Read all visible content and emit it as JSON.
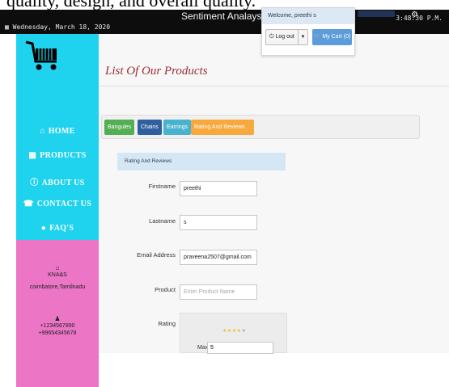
{
  "background_snippet": "quality, design, and overall quality.",
  "titlebar": {
    "date": "Wednesday, March 18, 2020",
    "title": "Sentiment Analaysis",
    "time": "3:48:30 P.M."
  },
  "sidebar": {
    "nav": [
      {
        "label": "HOME",
        "icon": "home-icon"
      },
      {
        "label": "PRODUCTS",
        "icon": "grid-icon"
      },
      {
        "label": "ABOUT US",
        "icon": "info-icon"
      },
      {
        "label": "CONTACT US",
        "icon": "phone-icon"
      },
      {
        "label": "FAQ'S",
        "icon": "chat-bubble-icon"
      }
    ],
    "contact": {
      "org": "KNA&S",
      "location": "coimbatore,Tamilnadu",
      "phone1": "+1234567890",
      "phone2": "+99654345678"
    }
  },
  "main": {
    "page_title": "List Of Our Products",
    "tabs": [
      {
        "label": "Bangules",
        "color": "#54ae54"
      },
      {
        "label": "Chains",
        "color": "#2f5f9e"
      },
      {
        "label": "Earrings",
        "color": "#48b2cf"
      },
      {
        "label": "Rating And Reviews",
        "color": "#f7a93d"
      }
    ],
    "panel_title": "Rating And Reviews",
    "form": {
      "firstname_label": "Firstname",
      "firstname_value": "preethi",
      "lastname_label": "Lastname",
      "lastname_value": "s",
      "email_label": "Email Address",
      "email_value": "praveena2507@gmail.com",
      "product_label": "Product",
      "product_placeholder": "Enter Product Name",
      "rating_label": "Rating",
      "max_label": "Max",
      "max_value": "5",
      "stars_filled": 4,
      "stars_total": 5
    }
  },
  "welcome": {
    "text": "Welcome, preethi s",
    "logout_label": "Log out",
    "cart_label": "My Cart (0)"
  },
  "colors": {
    "sidebar": "#1fd3ee",
    "contact_panel": "#ec75c6",
    "title_red": "#9b2d35",
    "cart_button": "#5d9cdb"
  }
}
